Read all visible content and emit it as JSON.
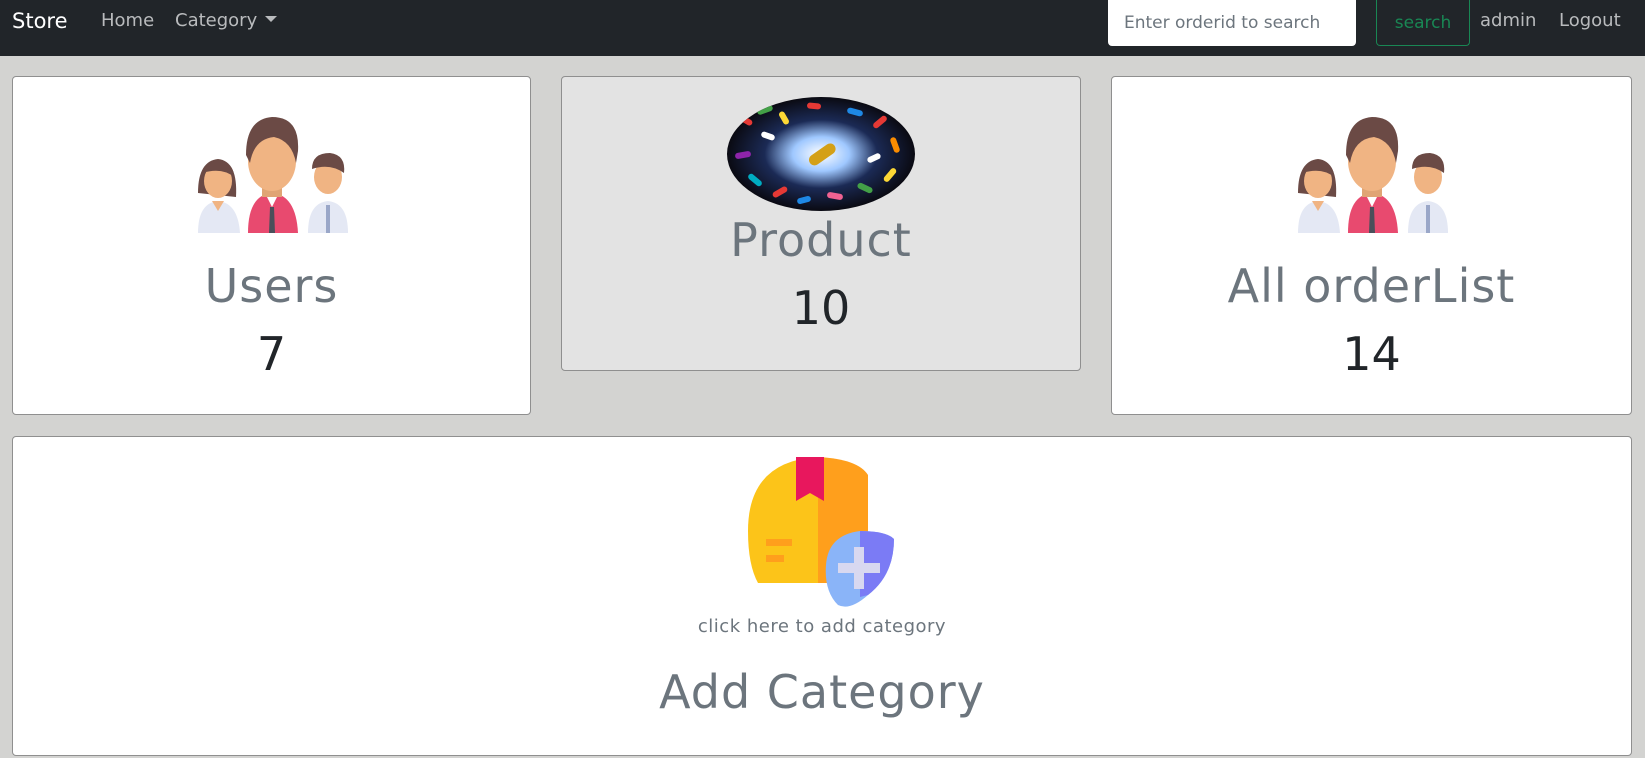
{
  "navbar": {
    "brand": "Store",
    "home_label": "Home",
    "category_label": "Category",
    "search_placeholder": "Enter orderid to search",
    "search_button": "search",
    "user_label": "admin",
    "logout_label": "Logout"
  },
  "cards": {
    "users": {
      "title": "Users",
      "count": "7",
      "icon": "users-group-icon"
    },
    "product": {
      "title": "Product",
      "count": "10",
      "icon": "pills-image"
    },
    "orders": {
      "title": "All orderList",
      "count": "14",
      "icon": "users-group-icon"
    },
    "add_category": {
      "hint": "click here to add category",
      "title": "Add Category",
      "icon": "add-category-box-icon"
    }
  },
  "colors": {
    "navbar_bg": "#212529",
    "page_bg": "#d3d3d1",
    "search_button": "#198754",
    "muted_text": "#6c757d"
  }
}
